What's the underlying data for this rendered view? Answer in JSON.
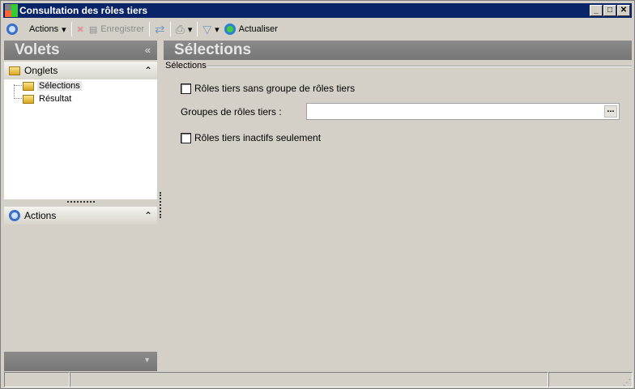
{
  "window": {
    "title": "Consultation des rôles tiers",
    "minimize": "_",
    "maximize": "□",
    "close": "✕"
  },
  "toolbar": {
    "actions": "Actions",
    "save": "Enregistrer",
    "refresh": "Actualiser"
  },
  "left": {
    "header": "Volets",
    "collapse": "«",
    "onglets": "Onglets",
    "tree": [
      "Sélections",
      "Résultat"
    ],
    "actions": "Actions",
    "chevron": "⌃"
  },
  "main": {
    "header": "Sélections",
    "group": "Sélections",
    "check1": "Rôles tiers sans groupe de rôles tiers",
    "field_label": "Groupes de rôles tiers :",
    "field_value": "",
    "browse": "...",
    "check2": "Rôles tiers inactifs seulement"
  }
}
